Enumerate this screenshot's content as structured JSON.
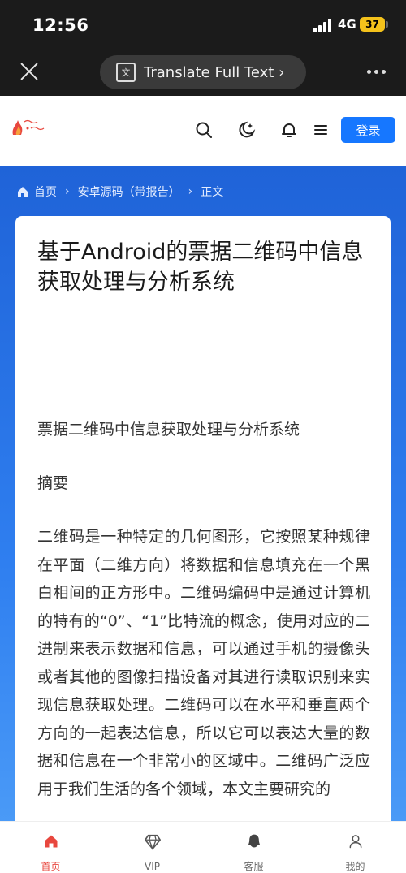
{
  "status_bar": {
    "time": "12:56",
    "network": "4G",
    "battery": "37"
  },
  "translate_bar": {
    "label": "Translate Full Text ›"
  },
  "header": {
    "login_label": "登录"
  },
  "breadcrumb": {
    "home": "首页",
    "sep": "›",
    "category": "安卓源码（带报告）",
    "current": "正文"
  },
  "article": {
    "title": "基于Android的票据二维码中信息获取处理与分析系统",
    "subtitle": "票据二维码中信息获取处理与分析系统",
    "abstract_heading": "摘要",
    "body": "二维码是一种特定的几何图形，它按照某种规律在平面（二维方向）将数据和信息填充在一个黑白相间的正方形中。二维码编码中是通过计算机的特有的“0”、“1”比特流的概念，使用对应的二进制来表示数据和信息，可以通过手机的摄像头或者其他的图像扫描设备对其进行读取识别来实现信息获取处理。二维码可以在水平和垂直两个方向的一起表达信息，所以它可以表达大量的数据和信息在一个非常小的区域中。二维码广泛应用于我们生活的各个领域，本文主要研究的"
  },
  "bottom_nav": [
    {
      "label": "首页",
      "icon": "home-icon",
      "active": true
    },
    {
      "label": "VIP",
      "icon": "diamond-icon",
      "active": false
    },
    {
      "label": "客服",
      "icon": "service-icon",
      "active": false
    },
    {
      "label": "我的",
      "icon": "user-icon",
      "active": false
    }
  ],
  "colors": {
    "accent": "#1677ff",
    "active_nav": "#e8473e",
    "hero_top": "#1f63d8",
    "hero_bottom": "#4b9bf7"
  }
}
